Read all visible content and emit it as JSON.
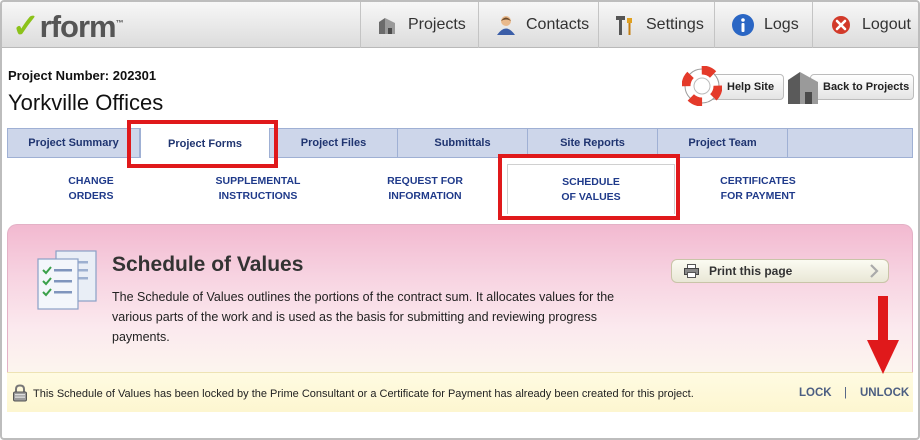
{
  "app": {
    "logo_text": "rform",
    "logo_mark": "✓",
    "logo_tm": "™"
  },
  "nav": [
    {
      "label": "Projects",
      "icon": "building-icon"
    },
    {
      "label": "Contacts",
      "icon": "person-icon"
    },
    {
      "label": "Settings",
      "icon": "tools-icon"
    },
    {
      "label": "Logs",
      "icon": "info-icon"
    },
    {
      "label": "Logout",
      "icon": "close-circle-icon"
    }
  ],
  "project": {
    "number_label": "Project Number: 202301",
    "title": "Yorkville Offices"
  },
  "header_buttons": {
    "help": "Help Site",
    "back": "Back to Projects"
  },
  "tabs": [
    {
      "label": "Project Summary"
    },
    {
      "label": "Project Forms"
    },
    {
      "label": "Project Files"
    },
    {
      "label": "Submittals"
    },
    {
      "label": "Site Reports"
    },
    {
      "label": "Project Team"
    }
  ],
  "active_tab": "Project Forms",
  "subtabs": [
    {
      "line1": "CHANGE",
      "line2": "ORDERS"
    },
    {
      "line1": "SUPPLEMENTAL",
      "line2": "INSTRUCTIONS"
    },
    {
      "line1": "REQUEST FOR",
      "line2": "INFORMATION"
    },
    {
      "line1": "SCHEDULE",
      "line2": "OF VALUES"
    },
    {
      "line1": "CERTIFICATES",
      "line2": "FOR PAYMENT"
    }
  ],
  "active_subtab": "SCHEDULE OF VALUES",
  "section": {
    "title": "Schedule of Values",
    "description": "The Schedule of Values outlines the portions of the contract sum. It allocates values for the various parts of the work and is used as the basis for submitting and reviewing progress payments.",
    "print_label": "Print this page"
  },
  "lock_bar": {
    "message": "This Schedule of Values has been locked by the Prime Consultant or a Certificate for Payment has already been created for this project.",
    "lock_label": "LOCK",
    "separator": "|",
    "unlock_label": "UNLOCK"
  },
  "colors": {
    "annotation_red": "#e0191b",
    "tab_bg": "#cdd6ea",
    "link_blue": "#1f3a8a",
    "logo_green": "#8cc21a"
  }
}
